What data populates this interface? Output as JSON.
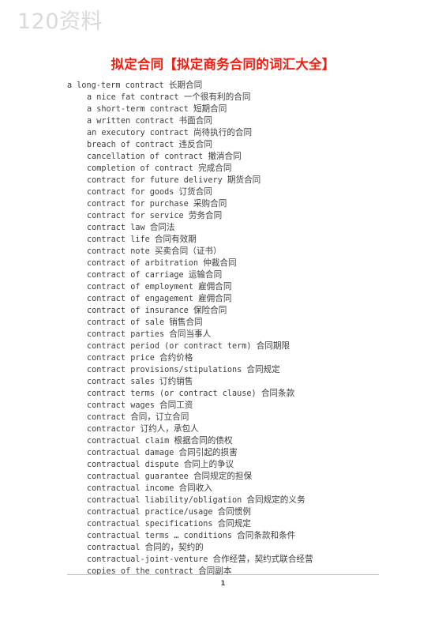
{
  "watermark": {
    "text": "120资料",
    "color": "#d9d9d9"
  },
  "title": {
    "text": "拟定合同【拟定商务合同的词汇大全】",
    "color": "#f41b0f"
  },
  "body": {
    "text_color": "#3d3d3d",
    "entries": [
      {
        "term": "a long-term contract",
        "cn": "长期合同",
        "lead": true
      },
      {
        "term": "a nice fat contract",
        "cn": "一个很有利的合同",
        "lead": false
      },
      {
        "term": "a short-term contract",
        "cn": "短期合同",
        "lead": false
      },
      {
        "term": "a written contract",
        "cn": "书面合同",
        "lead": false
      },
      {
        "term": "an executory contract",
        "cn": "尚待执行的合同",
        "lead": false
      },
      {
        "term": "breach of contract",
        "cn": "违反合同",
        "lead": false
      },
      {
        "term": "cancellation of contract",
        "cn": "撤消合同",
        "lead": false
      },
      {
        "term": "completion of contract",
        "cn": "完成合同",
        "lead": false
      },
      {
        "term": "contract for future delivery",
        "cn": "期货合同",
        "lead": false
      },
      {
        "term": "contract for goods",
        "cn": "订货合同",
        "lead": false
      },
      {
        "term": "contract for purchase",
        "cn": "采购合同",
        "lead": false
      },
      {
        "term": "contract for service",
        "cn": "劳务合同",
        "lead": false
      },
      {
        "term": "contract law",
        "cn": "合同法",
        "lead": false
      },
      {
        "term": "contract life",
        "cn": "合同有效期",
        "lead": false
      },
      {
        "term": "contract note",
        "cn": "买卖合同（证书）",
        "lead": false
      },
      {
        "term": "contract of arbitration",
        "cn": "仲裁合同",
        "lead": false
      },
      {
        "term": "contract of carriage",
        "cn": "运输合同",
        "lead": false
      },
      {
        "term": "contract of employment",
        "cn": "雇佣合同",
        "lead": false
      },
      {
        "term": "contract of engagement",
        "cn": "雇佣合同",
        "lead": false
      },
      {
        "term": "contract of insurance",
        "cn": "保险合同",
        "lead": false
      },
      {
        "term": "contract of sale",
        "cn": "销售合同",
        "lead": false
      },
      {
        "term": "contract parties",
        "cn": "合同当事人",
        "lead": false
      },
      {
        "term": "contract period (or contract term)",
        "cn": "合同期限",
        "lead": false
      },
      {
        "term": "contract price",
        "cn": "合约价格",
        "lead": false
      },
      {
        "term": "contract provisions/stipulations",
        "cn": "合同规定",
        "lead": false
      },
      {
        "term": "contract sales",
        "cn": "订约销售",
        "lead": false
      },
      {
        "term": "contract terms (or contract clause)",
        "cn": "合同条款",
        "lead": false
      },
      {
        "term": "contract wages",
        "cn": "合同工资",
        "lead": false
      },
      {
        "term": "contract",
        "cn": "合同，订立合同",
        "lead": false
      },
      {
        "term": "contractor",
        "cn": "订约人，承包人",
        "lead": false
      },
      {
        "term": "contractual claim",
        "cn": "根据合同的债权",
        "lead": false
      },
      {
        "term": "contractual damage",
        "cn": "合同引起的损害",
        "lead": false
      },
      {
        "term": "contractual dispute",
        "cn": "合同上的争议",
        "lead": false
      },
      {
        "term": "contractual guarantee",
        "cn": "合同规定的担保",
        "lead": false
      },
      {
        "term": "contractual income",
        "cn": "合同收入",
        "lead": false
      },
      {
        "term": "contractual liability/obligation",
        "cn": "合同规定的义务",
        "lead": false
      },
      {
        "term": "contractual practice/usage",
        "cn": "合同惯例",
        "lead": false
      },
      {
        "term": "contractual specifications",
        "cn": "合同规定",
        "lead": false
      },
      {
        "term": "contractual terms … conditions",
        "cn": "合同条款和条件",
        "lead": false
      },
      {
        "term": "contractual",
        "cn": "合同的，契约的",
        "lead": false
      },
      {
        "term": "contractual-joint-venture",
        "cn": "合作经营，契约式联合经营",
        "lead": false
      },
      {
        "term": "copies of the contract",
        "cn": "合同副本",
        "lead": false
      }
    ]
  },
  "footer": {
    "page_number": "1"
  }
}
